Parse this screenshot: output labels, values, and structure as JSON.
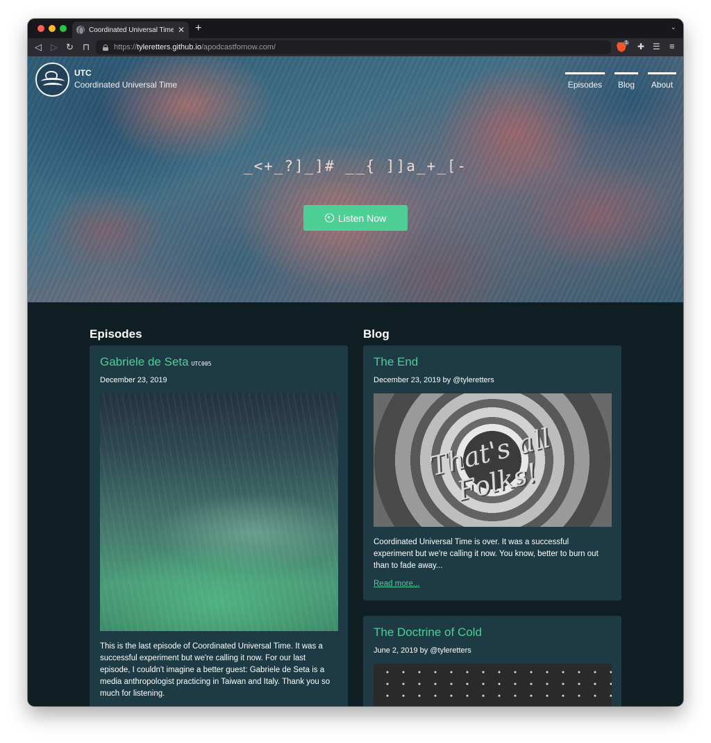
{
  "browser": {
    "tab_title": "Coordinated Universal Time | A",
    "tab_close": "✕",
    "new_tab": "+",
    "tab_menu": "⌄",
    "url_prefix": "https://",
    "url_host": "tyleretters.github.io",
    "url_path": "/apodcastfornow.com/",
    "extension_badge": "1"
  },
  "site": {
    "short_name": "UTC",
    "full_name": "Coordinated Universal Time",
    "nav": [
      "Episodes",
      "Blog",
      "About"
    ]
  },
  "hero": {
    "glyphs": "_<+_?]_]# __{ ]]a_+_[-",
    "listen_label": "Listen Now"
  },
  "episodes": {
    "heading": "Episodes",
    "items": [
      {
        "title": "Gabriele de Seta",
        "code": "UTC005",
        "date": "December 23, 2019",
        "description": "This is the last episode of Coordinated Universal Time. It was a successful experiment but we're calling it now. For our last episode, I couldn't imagine a better guest: Gabriele de Seta is a media anthropologist practicing in Taiwan and Italy. Thank you so much for listening."
      }
    ]
  },
  "blog": {
    "heading": "Blog",
    "posts": [
      {
        "title": "The End",
        "meta": "December 23, 2019 by @tyleretters",
        "image_text": "That's all Folks!",
        "excerpt": "Coordinated Universal Time is over. It was a successful experiment but we're calling it now. You know, better to burn out than to fade away...",
        "read_more": "Read more..."
      },
      {
        "title": "The Doctrine of Cold",
        "meta": "June 2, 2019 by @tyleretters"
      }
    ]
  },
  "colors": {
    "accent": "#4ecf95",
    "page_background": "#0f1e23",
    "card_background": "#1e3a45"
  }
}
